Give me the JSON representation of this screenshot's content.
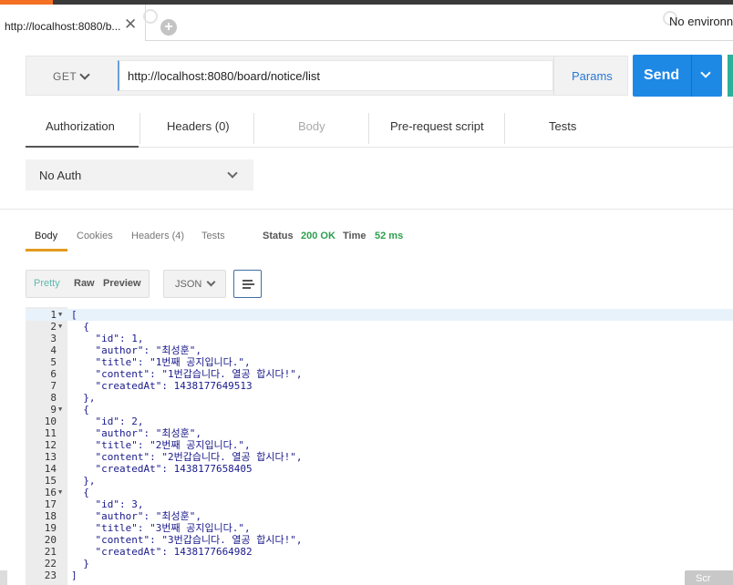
{
  "browser_tab": {
    "label": "http://localhost:8080/b...",
    "close": "✕",
    "add": "+"
  },
  "environment": {
    "label": "No environn"
  },
  "request": {
    "method": "GET",
    "url": "http://localhost:8080/board/notice/list",
    "params_label": "Params",
    "send_label": "Send"
  },
  "request_tabs": [
    {
      "label": "Authorization",
      "state": "active"
    },
    {
      "label": "Headers (0)",
      "state": "normal"
    },
    {
      "label": "Body",
      "state": "disabled"
    },
    {
      "label": "Pre-request script",
      "state": "normal"
    },
    {
      "label": "Tests",
      "state": "normal"
    }
  ],
  "auth": {
    "selected": "No Auth"
  },
  "response_tabs": [
    {
      "label": "Body",
      "active": true
    },
    {
      "label": "Cookies",
      "active": false
    },
    {
      "label": "Headers (4)",
      "active": false
    },
    {
      "label": "Tests",
      "active": false
    }
  ],
  "response_meta": {
    "status_label": "Status",
    "status_value": "200 OK",
    "time_label": "Time",
    "time_value": "52 ms"
  },
  "format_tabs": [
    {
      "label": "Pretty",
      "active": true
    },
    {
      "label": "Raw",
      "active": false
    },
    {
      "label": "Preview",
      "active": false
    }
  ],
  "response_format": {
    "selected": "JSON"
  },
  "code_lines": [
    {
      "num": "1",
      "fold": true,
      "text": "["
    },
    {
      "num": "2",
      "fold": true,
      "text": "  {"
    },
    {
      "num": "3",
      "fold": false,
      "text": "    \"id\": 1,"
    },
    {
      "num": "4",
      "fold": false,
      "text": "    \"author\": \"최성훈\","
    },
    {
      "num": "5",
      "fold": false,
      "text": "    \"title\": \"1번째 공지입니다.\","
    },
    {
      "num": "6",
      "fold": false,
      "text": "    \"content\": \"1번갑습니다. 열공 합시다!\","
    },
    {
      "num": "7",
      "fold": false,
      "text": "    \"createdAt\": 1438177649513"
    },
    {
      "num": "8",
      "fold": false,
      "text": "  },"
    },
    {
      "num": "9",
      "fold": true,
      "text": "  {"
    },
    {
      "num": "10",
      "fold": false,
      "text": "    \"id\": 2,"
    },
    {
      "num": "11",
      "fold": false,
      "text": "    \"author\": \"최성훈\","
    },
    {
      "num": "12",
      "fold": false,
      "text": "    \"title\": \"2번째 공지입니다.\","
    },
    {
      "num": "13",
      "fold": false,
      "text": "    \"content\": \"2번갑습니다. 열공 합시다!\","
    },
    {
      "num": "14",
      "fold": false,
      "text": "    \"createdAt\": 1438177658405"
    },
    {
      "num": "15",
      "fold": false,
      "text": "  },"
    },
    {
      "num": "16",
      "fold": true,
      "text": "  {"
    },
    {
      "num": "17",
      "fold": false,
      "text": "    \"id\": 3,"
    },
    {
      "num": "18",
      "fold": false,
      "text": "    \"author\": \"최성훈\","
    },
    {
      "num": "19",
      "fold": false,
      "text": "    \"title\": \"3번째 공지입니다.\","
    },
    {
      "num": "20",
      "fold": false,
      "text": "    \"content\": \"3번갑습니다. 열공 합시다!\","
    },
    {
      "num": "21",
      "fold": false,
      "text": "    \"createdAt\": 1438177664982"
    },
    {
      "num": "22",
      "fold": false,
      "text": "  }"
    },
    {
      "num": "23",
      "fold": false,
      "text": "]"
    }
  ],
  "scroll_button": {
    "label": "Scr"
  },
  "colors": {
    "send": "#1e88e5",
    "status_ok": "#2e9e4e",
    "active_underline": "#e39a1f",
    "pretty_active": "#5fb9b0"
  }
}
